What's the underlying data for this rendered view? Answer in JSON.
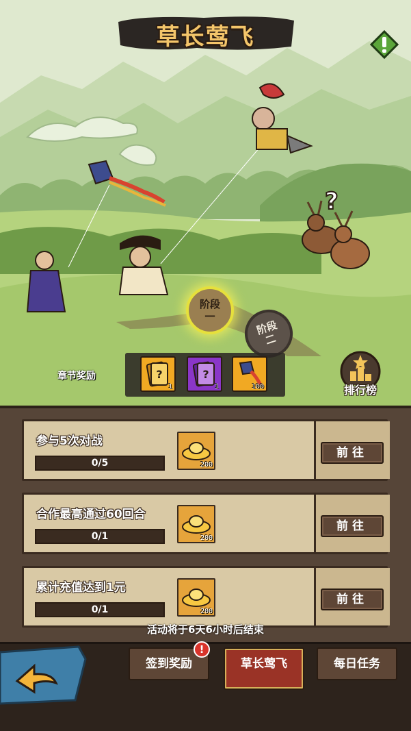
{
  "event": {
    "title": "草长莺飞",
    "info_icon": "exclamation-icon",
    "stages": [
      "阶段一",
      "阶段二"
    ],
    "active_stage": 1
  },
  "chapter_rewards": {
    "label": "章节奖励",
    "items": [
      {
        "name": "gold-card-icon",
        "qty": "1",
        "color": "#f1a923"
      },
      {
        "name": "purple-card-icon",
        "qty": "1",
        "color": "#8a36c8"
      },
      {
        "name": "kite-icon",
        "qty": "100",
        "color": "#f1a923"
      }
    ]
  },
  "leaderboard": {
    "label": "排行榜"
  },
  "tasks": [
    {
      "title": "参与5次对战",
      "progress_text": "0/5",
      "progress": 0,
      "reward_qty": "200",
      "button": "前往"
    },
    {
      "title": "合作最高通过60回合",
      "progress_text": "0/1",
      "progress": 0,
      "reward_qty": "200",
      "button": "前往"
    },
    {
      "title": "累计充值达到1元",
      "progress_text": "0/1",
      "progress": 0,
      "reward_qty": "200",
      "button": "前往"
    }
  ],
  "countdown": "活动将于6天6小时后结束",
  "bottom_tabs": [
    {
      "label": "签到奖励",
      "badge": "!"
    },
    {
      "label": "草长莺飞"
    },
    {
      "label": "每日任务"
    }
  ],
  "active_tab": 1
}
